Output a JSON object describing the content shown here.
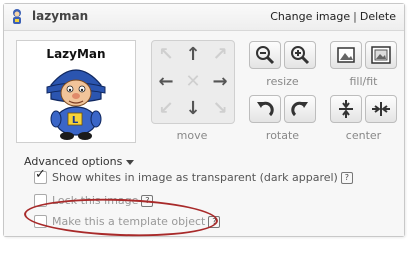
{
  "header": {
    "title": "lazyman",
    "change_image": "Change image",
    "separator": "|",
    "delete": "Delete"
  },
  "thumbnail": {
    "caption": "LazyMan",
    "badge": "L"
  },
  "controls": {
    "move_label": "move",
    "resize_label": "resize",
    "fill_fit_label": "fill/fit",
    "rotate_label": "rotate",
    "center_label": "center"
  },
  "advanced": {
    "label": "Advanced options",
    "options": [
      {
        "label": "Show whites in image as transparent (dark apparel)",
        "checked": true
      },
      {
        "label": "Lock this image",
        "checked": false
      },
      {
        "label": "Make this a template object",
        "checked": false
      }
    ],
    "help_glyph": "?"
  },
  "colors": {
    "annotation_oval": "#a82a2a",
    "accent_blue": "#2b5aa8"
  }
}
